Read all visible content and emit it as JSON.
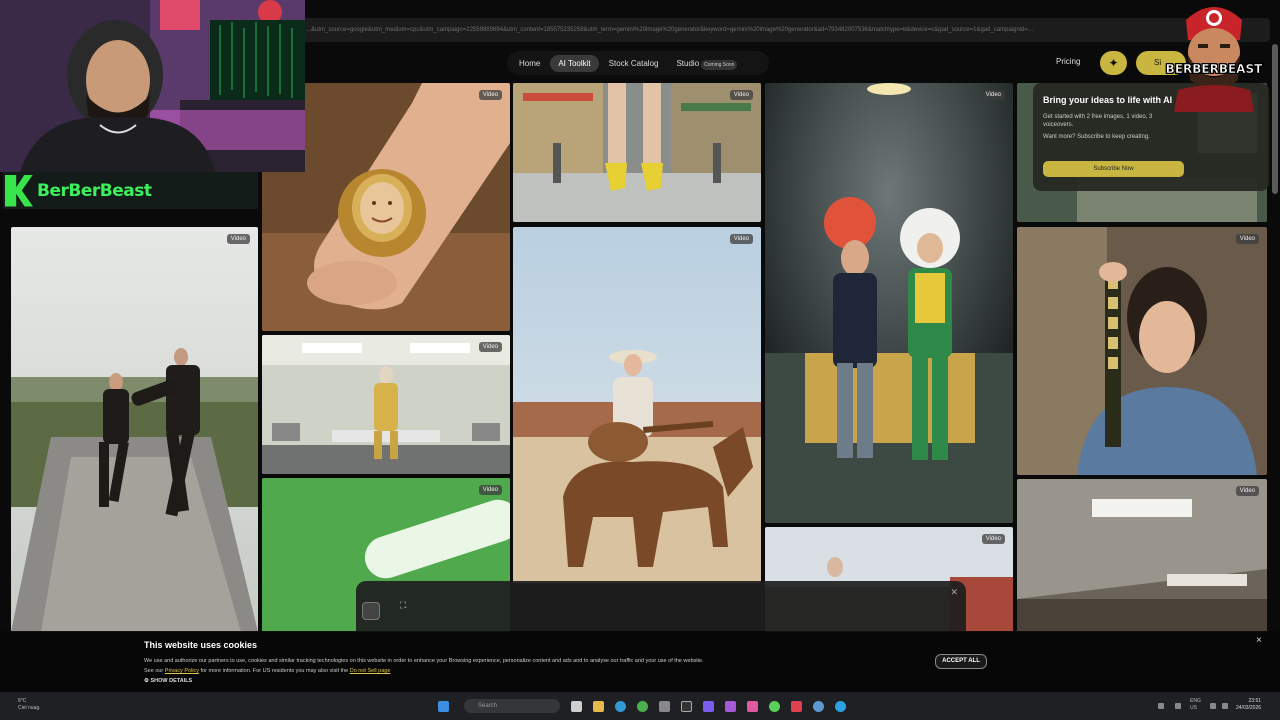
{
  "browser": {
    "url": "...&utm_source=google&utm_medium=cpc&utm_campaign=22559889694&utm_content=185575235258&utm_term=gemini%20image%20generator&keyword=gemini%20image%20generator&ad=793482007536&matchtype=b&device=c&gad_source=1&gad_campaignid=..."
  },
  "nav": {
    "items": [
      {
        "label": "Home",
        "active": false
      },
      {
        "label": "AI Toolkit",
        "active": true
      },
      {
        "label": "Stock Catalog",
        "active": false
      },
      {
        "label": "Studio",
        "active": false
      }
    ],
    "studio_badge": "Coming Soon",
    "pricing": "Pricing",
    "signup_label": "Si"
  },
  "gallery": {
    "badge_label": "Video"
  },
  "promo": {
    "title": "Bring your ideas to life with AI",
    "text1": "Get started with 2 free images, 1 video, 3 voiceovers.",
    "text2": "Want more? Subscribe to keep creating.",
    "button": "Subscribe Now"
  },
  "overlay": {
    "streamer_name": "BerBerBeast",
    "mascot_name": "BERBERBEAST"
  },
  "cookie": {
    "title": "This website uses cookies",
    "text": "We use and authorize our partners to use, cookies and similar tracking technologies on this website in order to enhance your Browsing experience, personalize content and ads and to analyse our traffic and your use of the website.",
    "text2_prefix": "See our",
    "privacy_link": "Privacy Policy",
    "text2_middle": "for more information. For US residents you may also visit the",
    "dns_link": "Do not Sell page",
    "show_details": "SHOW DETAILS",
    "accept_all": "ACCEPT ALL",
    "close": "×"
  },
  "taskbar": {
    "weather_temp": "8°C",
    "weather_desc": "Ciel nuag.",
    "search_placeholder": "Search",
    "lang": "ENG",
    "lang2": "US",
    "time": "23:51",
    "date": "24/03/2026"
  },
  "colors": {
    "accent": "#c8b640",
    "streamer_green": "#3cf05a"
  }
}
